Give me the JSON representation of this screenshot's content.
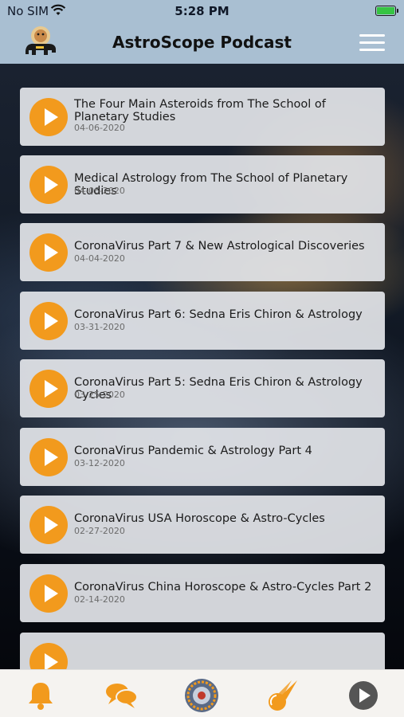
{
  "status_bar": {
    "carrier": "No SIM",
    "time": "5:28 PM"
  },
  "nav": {
    "title": "AstroScope Podcast",
    "logo_icon": "bear-astronaut-logo",
    "menu_icon": "hamburger-menu-icon"
  },
  "colors": {
    "nav_background": "#a9bfd2",
    "accent_orange": "#f29a1d",
    "card_background": "#e2e4e8",
    "battery_green": "#36c443"
  },
  "episodes": [
    {
      "title": "The Four Main Asteroids from The School of Planetary Studies",
      "date": "04-06-2020"
    },
    {
      "title": "Medical Astrology from The School of Planetary Studies",
      "date": "04-06-2020"
    },
    {
      "title": "CoronaVirus Part 7 & New Astrological Discoveries",
      "date": "04-04-2020"
    },
    {
      "title": "CoronaVirus Part 6: Sedna Eris Chiron & Astrology",
      "date": "03-31-2020"
    },
    {
      "title": "CoronaVirus Part 5: Sedna Eris Chiron & Astrology Cycles",
      "date": "03-25-2020"
    },
    {
      "title": "CoronaVirus Pandemic & Astrology Part 4",
      "date": "03-12-2020"
    },
    {
      "title": "CoronaVirus USA Horoscope & Astro-Cycles",
      "date": "02-27-2020"
    },
    {
      "title": "CoronaVirus China Horoscope & Astro-Cycles Part 2",
      "date": "02-14-2020"
    }
  ],
  "tabs": [
    {
      "icon": "bell-icon"
    },
    {
      "icon": "chat-bubbles-icon"
    },
    {
      "icon": "astrology-wheel-icon"
    },
    {
      "icon": "comet-icon"
    },
    {
      "icon": "play-circle-icon"
    }
  ]
}
